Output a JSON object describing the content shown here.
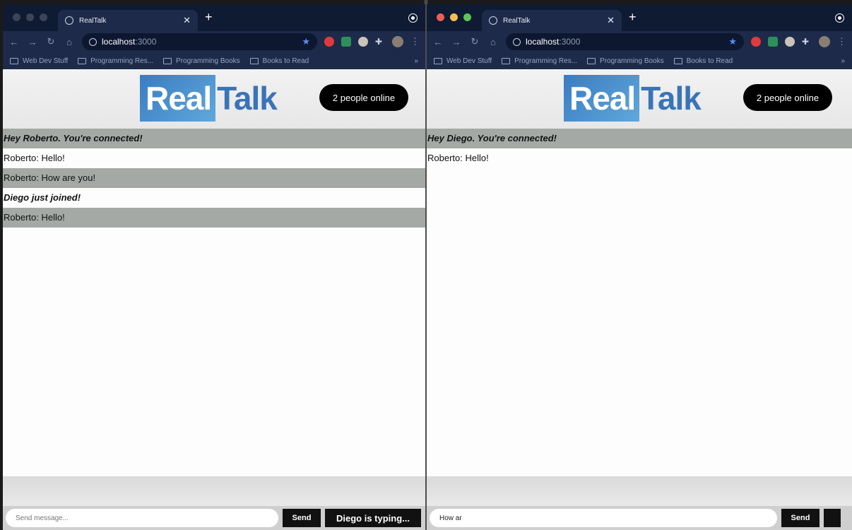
{
  "left": {
    "tab_title": "RealTalk",
    "url_host": "localhost",
    "url_port": ":3000",
    "bookmarks": [
      "Web Dev Stuff",
      "Programming Res...",
      "Programming Books",
      "Books to Read"
    ],
    "logo_real": "Real",
    "logo_talk": "Talk",
    "online": "2 people online",
    "messages": [
      {
        "text": "Hey Roberto. You're connected!",
        "system": true,
        "shaded": true
      },
      {
        "text": "Roberto: Hello!",
        "system": false,
        "shaded": false
      },
      {
        "text": "Roberto: How are you!",
        "system": false,
        "shaded": true
      },
      {
        "text": "Diego just joined!",
        "system": true,
        "shaded": false
      },
      {
        "text": "Roberto: Hello!",
        "system": false,
        "shaded": true
      }
    ],
    "input_value": "",
    "input_placeholder": "Send message...",
    "send_label": "Send",
    "typing_label": "Diego is typing..."
  },
  "right": {
    "tab_title": "RealTalk",
    "url_host": "localhost",
    "url_port": ":3000",
    "bookmarks": [
      "Web Dev Stuff",
      "Programming Res...",
      "Programming Books",
      "Books to Read"
    ],
    "logo_real": "Real",
    "logo_talk": "Talk",
    "online": "2 people online",
    "messages": [
      {
        "text": "Hey Diego. You're connected!",
        "system": true,
        "shaded": true
      },
      {
        "text": "Roberto: Hello!",
        "system": false,
        "shaded": false
      }
    ],
    "input_value": "How ar",
    "input_placeholder": "Send message...",
    "send_label": "Send",
    "typing_label": ""
  },
  "colors": {
    "brand_blue": "#3a74b8",
    "chrome_dark": "#1d2a4a",
    "shade": "#a4a9a6"
  },
  "icons": [
    "globe-icon",
    "close-icon",
    "plus-icon",
    "back-icon",
    "forward-icon",
    "reload-icon",
    "home-icon",
    "info-icon",
    "star-icon",
    "folder-icon",
    "puzzle-icon"
  ]
}
